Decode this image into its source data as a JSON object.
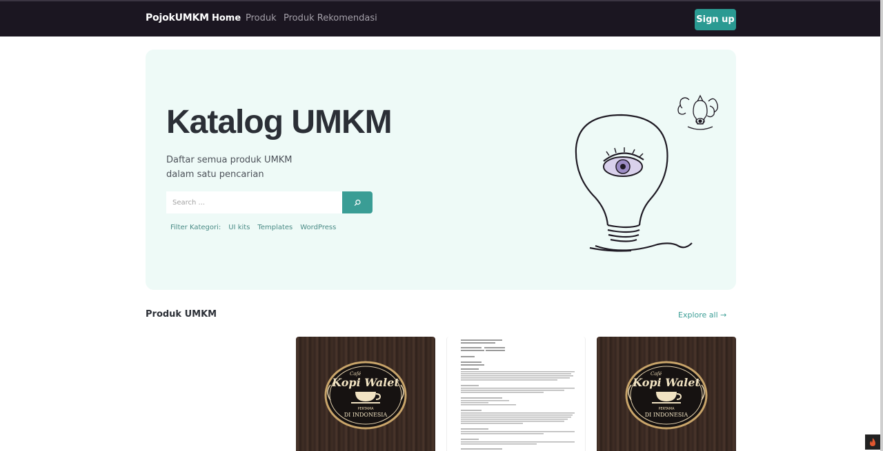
{
  "nav": {
    "brand": "PojokUMKM",
    "links": [
      {
        "label": "Home",
        "active": true
      },
      {
        "label": "Produk",
        "active": false
      },
      {
        "label": "Produk Rekomendasi",
        "active": false
      }
    ],
    "signup_label": "Sign up"
  },
  "hero": {
    "title": "Katalog UMKM",
    "subtitle_line1": "Daftar semua produk UMKM",
    "subtitle_line2": "dalam satu pencarian",
    "search_placeholder": "Search ...",
    "search_icon": "search-icon",
    "filter_label": "Filter Kategori:",
    "filters": [
      "UI kits",
      "Templates",
      "WordPress"
    ],
    "illustration": "lightbulb-eye-illustration"
  },
  "products": {
    "title": "Produk UMKM",
    "explore_label": "Explore all →",
    "cards": [
      {
        "type": "logo",
        "logo_brand": "Kopi Walet",
        "logo_small": "Café",
        "logo_sub": "PERTAMA",
        "logo_bottom": "DI INDONESIA"
      },
      {
        "type": "document"
      },
      {
        "type": "logo",
        "logo_brand": "Kopi Walet",
        "logo_small": "Café",
        "logo_sub": "PERTAMA",
        "logo_bottom": "DI INDONESIA"
      }
    ]
  },
  "colors": {
    "navbar": "#1b1621",
    "accent": "#2a9a92",
    "hero_bg": "#eefaf7"
  }
}
